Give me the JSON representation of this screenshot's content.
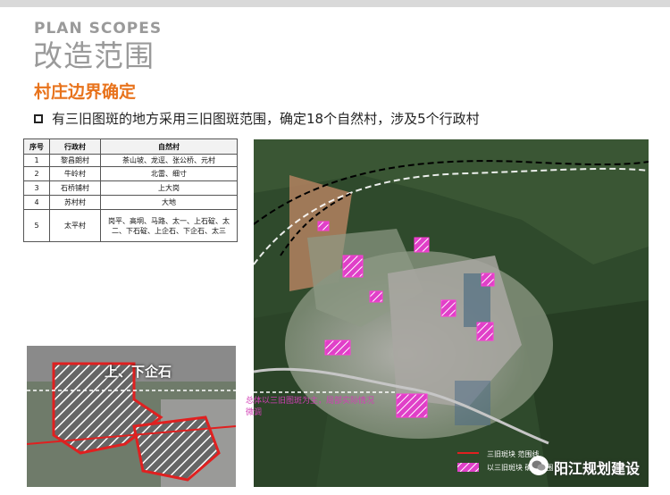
{
  "header": {
    "en_title": "PLAN SCOPES",
    "cn_title": "改造范围"
  },
  "section_title": "村庄边界确定",
  "bullet": "有三旧图斑的地方采用三旧图斑范围，确定18个自然村，涉及5个行政村",
  "table": {
    "headers": [
      "序号",
      "行政村",
      "自然村"
    ],
    "rows": [
      [
        "1",
        "黎昌朗村",
        "茶山坡、龙逕、张公桥、元村"
      ],
      [
        "2",
        "牛岭村",
        "北雷、细寸"
      ],
      [
        "3",
        "石桥铺村",
        "上大岗"
      ],
      [
        "4",
        "苏村村",
        "大地"
      ],
      [
        "5",
        "太平村",
        "岗平、高垌、马路、太一、上石碇、太二、下石碇、上企石、下企石、太三"
      ]
    ]
  },
  "inset_label": "上、下企石",
  "annotation": "总体以三旧图斑为主，局部实际情况微调",
  "legend": {
    "line_label": "三旧斑块 范围线",
    "hatch_label": "以三旧斑块 确定范围"
  },
  "watermark": "阳江规划建设",
  "colors": {
    "orange": "#e8731c",
    "title_gray": "#9a9a9a",
    "magenta": "#d23fb6",
    "boundary_red": "#e02020"
  }
}
